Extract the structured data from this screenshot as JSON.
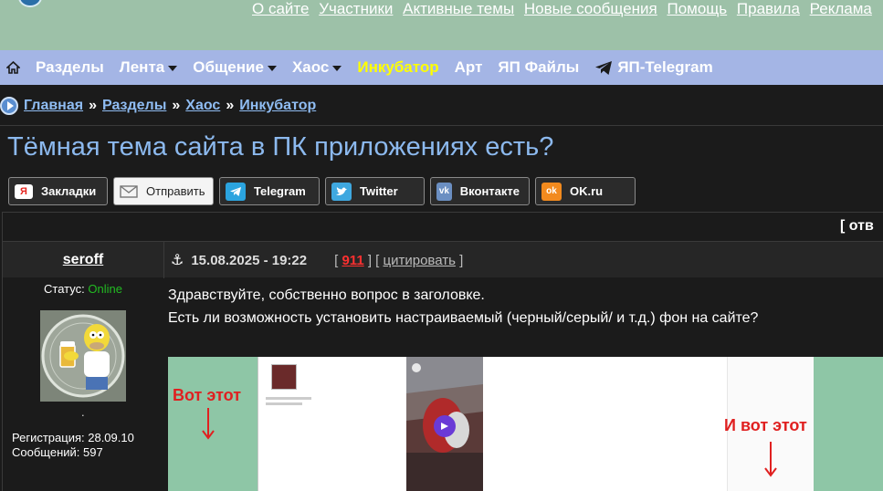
{
  "top_links": [
    "О сайте",
    "Участники",
    "Активные темы",
    "Новые сообщения",
    "Помощь",
    "Правила",
    "Реклама"
  ],
  "nav": {
    "items": [
      {
        "label": "Разделы",
        "dropdown": false
      },
      {
        "label": "Лента",
        "dropdown": true
      },
      {
        "label": "Общение",
        "dropdown": true
      },
      {
        "label": "Хаос",
        "dropdown": true
      },
      {
        "label": "Инкубатор",
        "dropdown": false,
        "color": "#ffff00"
      },
      {
        "label": "Арт",
        "dropdown": false
      },
      {
        "label": "ЯП Файлы",
        "dropdown": false
      },
      {
        "label": "ЯП-Telegram",
        "dropdown": false,
        "icon": "telegram-plane-icon"
      }
    ]
  },
  "breadcrumb": {
    "items": [
      "Главная",
      "Разделы",
      "Хаос",
      "Инкубатор"
    ],
    "separator": "»"
  },
  "topic": {
    "title": "Тёмная тема сайта в ПК приложениях есть?"
  },
  "share": {
    "buttons": [
      {
        "label": "Закладки",
        "icon": "yandex-bookmarks-icon",
        "icon_text": "Я",
        "color": "#ffffff"
      },
      {
        "label": "Отправить",
        "icon": "mail-icon",
        "icon_text": "",
        "color": "#f4f4f4"
      },
      {
        "label": "Telegram",
        "icon": "telegram-icon",
        "icon_text": "",
        "color": "#2ba4df"
      },
      {
        "label": "Twitter",
        "icon": "twitter-icon",
        "icon_text": "",
        "color": "#3fa8e0"
      },
      {
        "label": "Вконтакте",
        "icon": "vk-icon",
        "icon_text": "vk",
        "color": "#6b8fc2"
      },
      {
        "label": "OK.ru",
        "icon": "odnoklassniki-icon",
        "icon_text": "ok",
        "color": "#f28a1e"
      }
    ]
  },
  "reply_label": "[ отв",
  "post": {
    "author": "seroff",
    "date": "15.08.2025 - 19:22",
    "number": "911",
    "quote_label": "цитировать",
    "status_label": "Статус:",
    "status_value": "Online",
    "user_dot": ".",
    "registration_label": "Регистрация:",
    "registration_value": "28.09.10",
    "messages_label": "Сообщений:",
    "messages_value": "597",
    "body_lines": [
      "Здравствуйте, собственно вопрос в заголовке.",
      "Есть ли возможность установить настраиваемый (черный/серый/ и т.д.) фон на сайте?"
    ],
    "image": {
      "label_left": "Вот этот",
      "label_right": "И вот этот"
    }
  },
  "colors": {
    "header_bg": "#9dc1a8",
    "nav_bg": "#a4b5e5",
    "page_bg": "#1b1b1b",
    "link": "#8fbcf2",
    "title": "#8cb9ee",
    "online": "#22bb22",
    "post_number": "#ff3030"
  }
}
